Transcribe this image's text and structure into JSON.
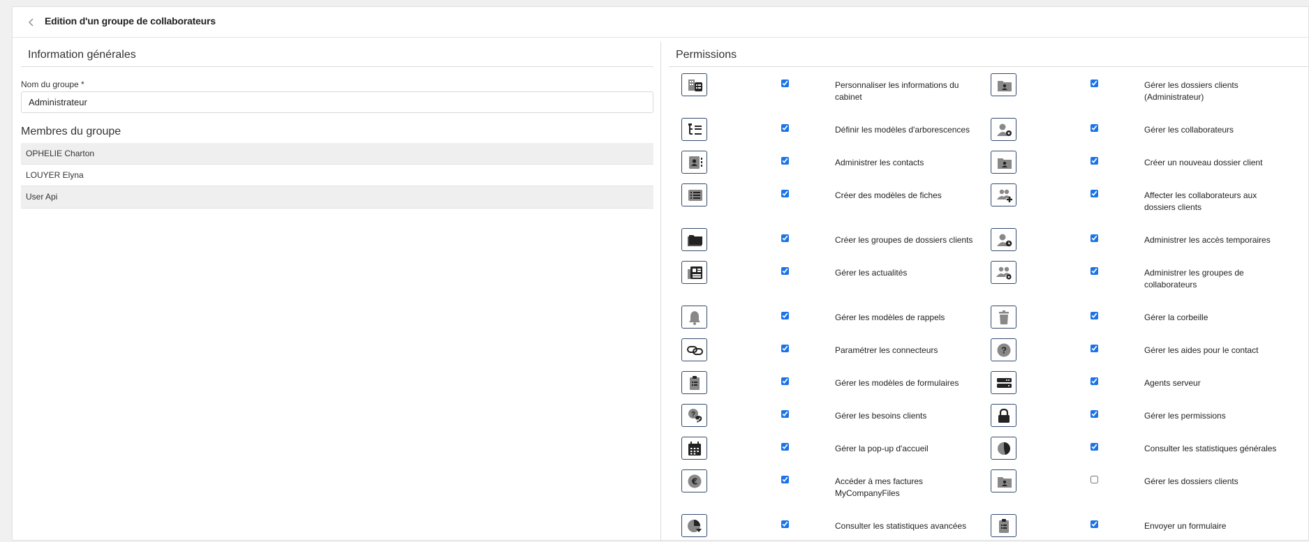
{
  "header": {
    "title": "Edition d'un groupe de collaborateurs"
  },
  "info": {
    "title": "Information générales",
    "name_label": "Nom du groupe *",
    "name_value": "Administrateur"
  },
  "members": {
    "title": "Membres du groupe",
    "items": [
      "OPHELIE Charton",
      "LOUYER Elyna",
      "User Api"
    ]
  },
  "permissions": {
    "title": "Permissions",
    "items": [
      {
        "label": "Personnaliser les informations du cabinet",
        "checked": true,
        "icon": "building-list-icon"
      },
      {
        "label": "Gérer les dossiers clients (Administrateur)",
        "checked": true,
        "icon": "client-folder-icon"
      },
      {
        "label": "Définir les modèles d'arborescences",
        "checked": true,
        "icon": "tree-list-icon"
      },
      {
        "label": "Gérer les collaborateurs",
        "checked": true,
        "icon": "user-gear-icon"
      },
      {
        "label": "Administrer les contacts",
        "checked": true,
        "icon": "contact-book-icon"
      },
      {
        "label": "Créer un nouveau dossier client",
        "checked": true,
        "icon": "client-folder-icon"
      },
      {
        "label": "Créer des modèles de fiches",
        "checked": true,
        "icon": "list-card-icon"
      },
      {
        "label": "Affecter les collaborateurs aux dossiers clients",
        "checked": true,
        "icon": "users-plus-icon"
      },
      {
        "label": "Créer les groupes de dossiers clients",
        "checked": true,
        "icon": "folders-icon"
      },
      {
        "label": "Administrer les accès temporaires",
        "checked": true,
        "icon": "user-clock-icon"
      },
      {
        "label": "Gérer les actualités",
        "checked": true,
        "icon": "newspaper-icon"
      },
      {
        "label": "Administrer les groupes de collaborateurs",
        "checked": true,
        "icon": "users-gear-icon"
      },
      {
        "label": "Gérer les modèles de rappels",
        "checked": true,
        "icon": "bell-icon"
      },
      {
        "label": "Gérer la corbeille",
        "checked": true,
        "icon": "trash-icon"
      },
      {
        "label": "Paramétrer les connecteurs",
        "checked": true,
        "icon": "link-icon"
      },
      {
        "label": "Gérer les aides pour le contact",
        "checked": true,
        "icon": "question-icon"
      },
      {
        "label": "Gérer les modèles de formulaires",
        "checked": true,
        "icon": "clipboard-list-icon"
      },
      {
        "label": "Agents serveur",
        "checked": true,
        "icon": "server-icon"
      },
      {
        "label": "Gérer les besoins clients",
        "checked": true,
        "icon": "question-chat-icon"
      },
      {
        "label": "Gérer les permissions",
        "checked": true,
        "icon": "lock-icon"
      },
      {
        "label": "Gérer la pop-up d'accueil",
        "checked": true,
        "icon": "calendar-icon"
      },
      {
        "label": "Consulter les statistiques générales",
        "checked": true,
        "icon": "pie-chart-icon"
      },
      {
        "label": "Accéder à mes factures MyCompanyFiles",
        "checked": true,
        "icon": "euro-icon"
      },
      {
        "label": "Gérer les dossiers clients",
        "checked": false,
        "icon": "client-folder-icon"
      },
      {
        "label": "Consulter les statistiques avancées",
        "checked": true,
        "icon": "pie-chart-down-icon"
      },
      {
        "label": "Envoyer un formulaire",
        "checked": true,
        "icon": "clipboard-list-icon"
      }
    ]
  },
  "colors": {
    "icon_border": "#33496b",
    "icon_fill": "#888888",
    "row_shade": "#efefef",
    "checkbox": "#1a73e8"
  }
}
